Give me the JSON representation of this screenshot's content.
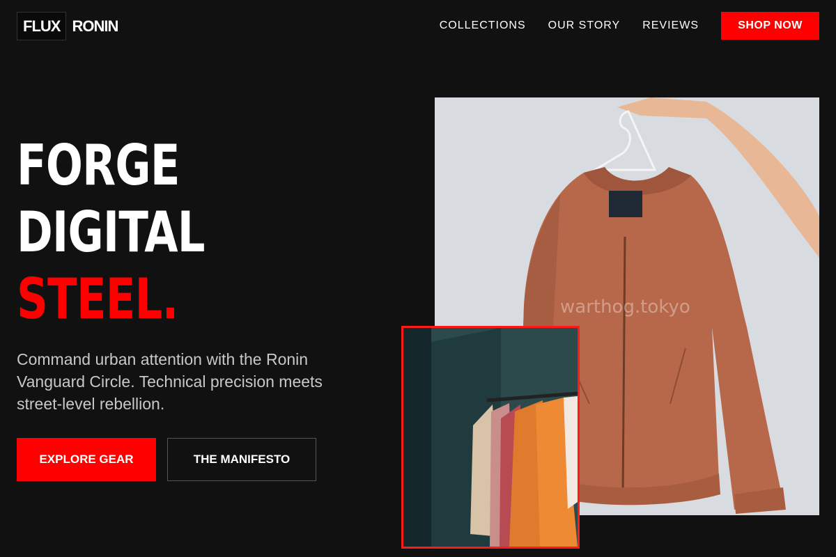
{
  "brand": {
    "box_text": "FLUX",
    "word": "RONIN"
  },
  "nav": {
    "links": [
      "COLLECTIONS",
      "OUR STORY",
      "REVIEWS"
    ],
    "cta": "SHOP NOW"
  },
  "hero": {
    "headline_lines": [
      "FORGE",
      "DIGITAL",
      "STEEL."
    ],
    "lede": "Command urban attention with the Ronin Vanguard Circle. Technical precision meets street-level rebellion.",
    "primary_button": "EXPLORE GEAR",
    "secondary_button": "THE MANIFESTO"
  },
  "images": {
    "main_watermark": "warthog.tokyo"
  },
  "colors": {
    "background": "#111111",
    "accent": "#ff0000",
    "text": "#ffffff",
    "muted_text": "#c8c8c8"
  }
}
